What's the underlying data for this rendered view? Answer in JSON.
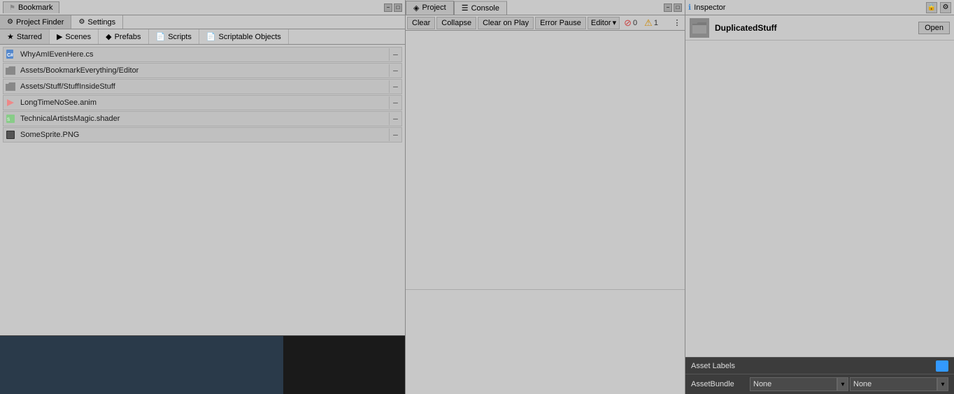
{
  "leftPanel": {
    "title": "Bookmark",
    "tabs": [
      {
        "id": "project-finder",
        "label": "Project Finder",
        "icon": "⚙"
      },
      {
        "id": "settings",
        "label": "Settings",
        "icon": "⚙"
      }
    ],
    "subTabs": [
      {
        "id": "starred",
        "label": "Starred",
        "icon": "★",
        "active": true
      },
      {
        "id": "scenes",
        "label": "Scenes",
        "icon": "▶"
      },
      {
        "id": "prefabs",
        "label": "Prefabs",
        "icon": "◆"
      },
      {
        "id": "scripts",
        "label": "Scripts",
        "icon": "📄"
      },
      {
        "id": "scriptable-objects",
        "label": "Scriptable Objects",
        "icon": "📄"
      }
    ],
    "bookmarks": [
      {
        "id": "bm1",
        "label": "WhyAmIEvenHere.cs",
        "iconType": "cs"
      },
      {
        "id": "bm2",
        "label": "Assets/BookmarkEverything/Editor",
        "iconType": "folder"
      },
      {
        "id": "bm3",
        "label": "Assets/Stuff/StuffInsideStuff",
        "iconType": "folder"
      },
      {
        "id": "bm4",
        "label": "LongTimeNoSee.anim",
        "iconType": "anim"
      },
      {
        "id": "bm5",
        "label": "TechnicalArtistsMagic.shader",
        "iconType": "shader"
      },
      {
        "id": "bm6",
        "label": "SomeSprite.PNG",
        "iconType": "png"
      }
    ]
  },
  "middlePanel": {
    "tabs": [
      {
        "id": "project",
        "label": "Project",
        "icon": "◈",
        "active": false
      },
      {
        "id": "console",
        "label": "Console",
        "icon": "☰",
        "active": true
      }
    ],
    "toolbar": {
      "clearLabel": "Clear",
      "collapseLabel": "Collapse",
      "clearOnPlayLabel": "Clear on Play",
      "errorPauseLabel": "Error Pause",
      "editorLabel": "Editor",
      "editorDropdown": "▾",
      "errorCount": "0",
      "warningCount": "1"
    }
  },
  "rightPanel": {
    "title": "Inspector",
    "assetName": "DuplicatedStuff",
    "openButton": "Open",
    "assetLabels": "Asset Labels",
    "assetBundle": {
      "label": "AssetBundle",
      "value1": "None",
      "value2": "None"
    }
  },
  "icons": {
    "info": "ℹ",
    "warning": "⚠",
    "error": "⊘",
    "close": "✕",
    "minimize": "−",
    "settings": "⚙",
    "chevronDown": "▾",
    "bookmark": "⚑",
    "folder": "📁",
    "lock": "🔒",
    "minus": "−"
  }
}
